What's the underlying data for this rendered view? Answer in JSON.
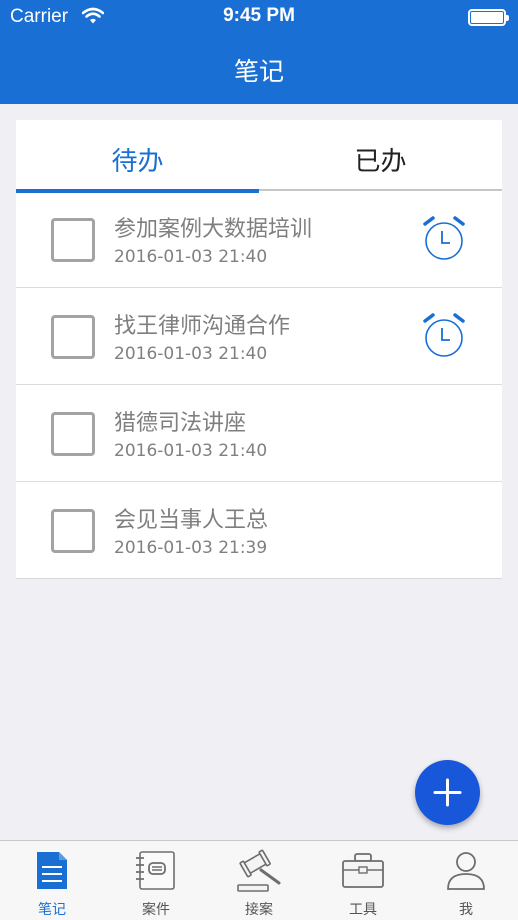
{
  "status_bar": {
    "carrier": "Carrier",
    "time": "9:45 PM"
  },
  "nav": {
    "title": "笔记"
  },
  "tabs": [
    {
      "label": "待办",
      "active": true
    },
    {
      "label": "已办",
      "active": false
    }
  ],
  "todos": [
    {
      "title": "参加案例大数据培训",
      "time": "2016-01-03 21:40",
      "checked": false,
      "alarm": true
    },
    {
      "title": "找王律师沟通合作",
      "time": "2016-01-03 21:40",
      "checked": false,
      "alarm": true
    },
    {
      "title": "猎德司法讲座",
      "time": "2016-01-03 21:40",
      "checked": false,
      "alarm": false
    },
    {
      "title": "会见当事人王总",
      "time": "2016-01-03 21:39",
      "checked": false,
      "alarm": false
    }
  ],
  "fab": {
    "icon": "plus-icon"
  },
  "tab_bar": [
    {
      "label": "笔记",
      "icon": "notes-icon",
      "active": true
    },
    {
      "label": "案件",
      "icon": "case-notebook-icon",
      "active": false
    },
    {
      "label": "接案",
      "icon": "gavel-icon",
      "active": false
    },
    {
      "label": "工具",
      "icon": "toolbox-icon",
      "active": false
    },
    {
      "label": "我",
      "icon": "user-icon",
      "active": false
    }
  ],
  "colors": {
    "primary": "#1a6fd4",
    "fab": "#1857d9",
    "background": "#efeff4",
    "text_gray": "#7f7f7f"
  }
}
